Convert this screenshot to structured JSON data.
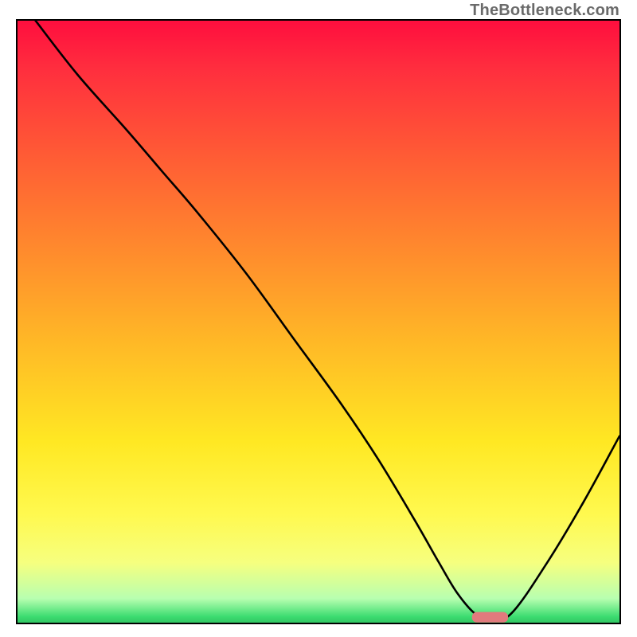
{
  "watermark": "TheBottleneck.com",
  "chart_data": {
    "type": "line",
    "title": "",
    "xlabel": "",
    "ylabel": "",
    "xlim": [
      0,
      100
    ],
    "ylim": [
      0,
      100
    ],
    "grid": false,
    "legend": false,
    "note": "Axes are unlabeled; x and y treated as 0–100 percent of frame. Curve read off pixel positions. Marker is a small horizontal pill near the minimum.",
    "series": [
      {
        "name": "bottleneck-curve",
        "x": [
          3,
          10,
          18,
          24,
          30,
          38,
          46,
          54,
          60,
          66,
          70,
          73,
          76,
          78.5,
          82,
          88,
          94,
          100
        ],
        "y": [
          100,
          91,
          82,
          75,
          68,
          58,
          47,
          36,
          27,
          17,
          10,
          5,
          1.5,
          0.6,
          1.5,
          10,
          20,
          31
        ]
      }
    ],
    "marker": {
      "name": "optimal-range-pill",
      "x_start": 75.5,
      "x_end": 81.5,
      "y": 0.9,
      "color": "#e17a7d"
    },
    "background_gradient": {
      "type": "vertical",
      "stops": [
        {
          "pos": 0.0,
          "color": "#ff0e3e"
        },
        {
          "pos": 0.22,
          "color": "#ff5a35"
        },
        {
          "pos": 0.54,
          "color": "#ffba26"
        },
        {
          "pos": 0.82,
          "color": "#fff94f"
        },
        {
          "pos": 0.96,
          "color": "#b8ffb0"
        },
        {
          "pos": 1.0,
          "color": "#32c764"
        }
      ]
    }
  }
}
